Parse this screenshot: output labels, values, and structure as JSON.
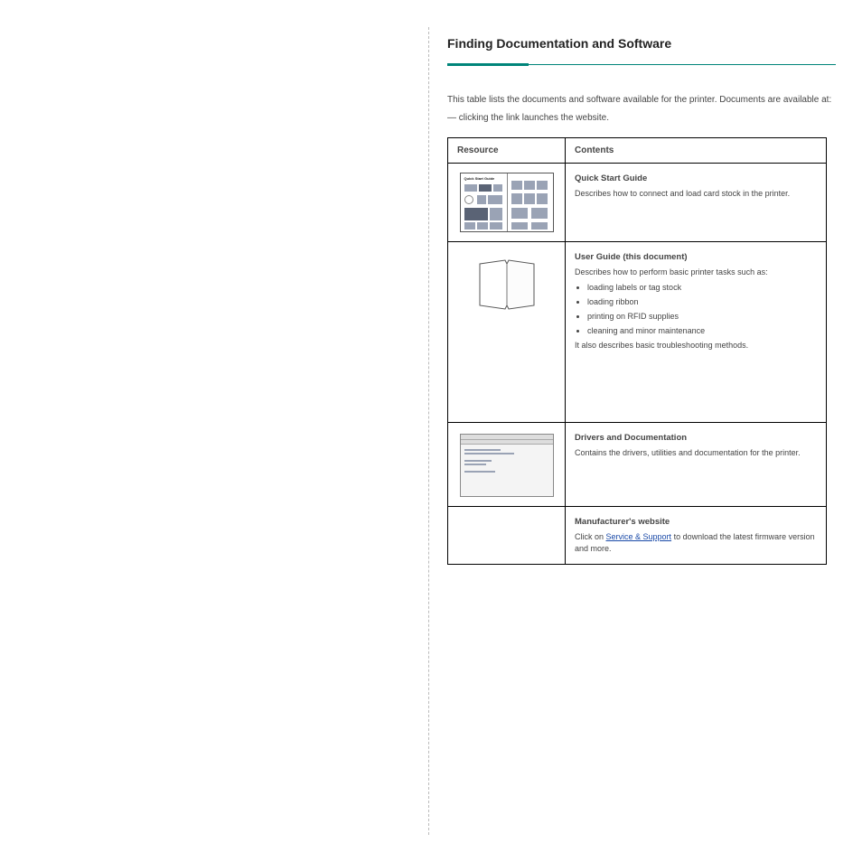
{
  "header": "Finding Documentation and Software",
  "intro": "This table lists the documents and software available for the printer. Documents are available at:",
  "note_line": "— clicking the link launches the website.",
  "table": {
    "headers": [
      "Resource",
      "Contents"
    ],
    "rows": [
      {
        "title": "Quick Start Guide",
        "body": "Describes how to connect and load card stock in the printer."
      },
      {
        "title": "User Guide (this document)",
        "body_intro": "Describes how to perform basic printer tasks such as:",
        "bullets": [
          "loading labels or tag stock",
          "loading ribbon",
          "printing on RFID supplies",
          "cleaning and minor maintenance"
        ],
        "body_outro": "It also describes basic troubleshooting methods."
      },
      {
        "title": "Drivers and Documentation",
        "body": "Contains the drivers, utilities and documentation for the printer."
      },
      {
        "title": "Manufacturer's website",
        "body_prefix": "Click on ",
        "link": "Service & Support",
        "body_suffix": " to download the latest firmware version and more."
      }
    ]
  }
}
